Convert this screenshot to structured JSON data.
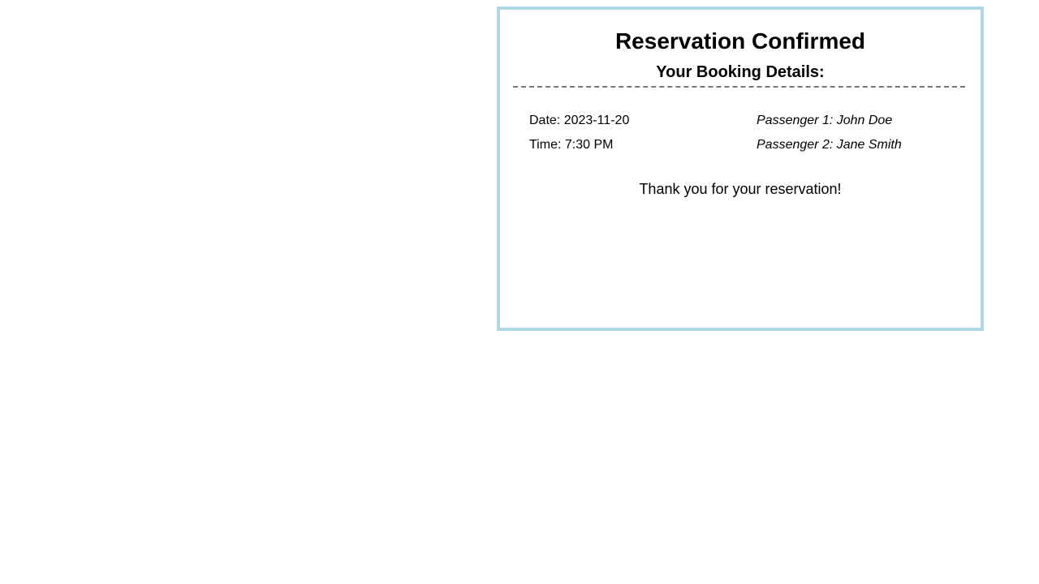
{
  "confirmation": {
    "title": "Reservation Confirmed",
    "subtitle": "Your Booking Details:",
    "date": "Date: 2023-11-20",
    "time": "Time: 7:30 PM",
    "passengers": [
      "Passenger 1: John Doe",
      "Passenger 2: Jane Smith"
    ],
    "thanks": "Thank you for your reservation!"
  },
  "colors": {
    "border": "#add8e6",
    "divider": "#777777"
  }
}
